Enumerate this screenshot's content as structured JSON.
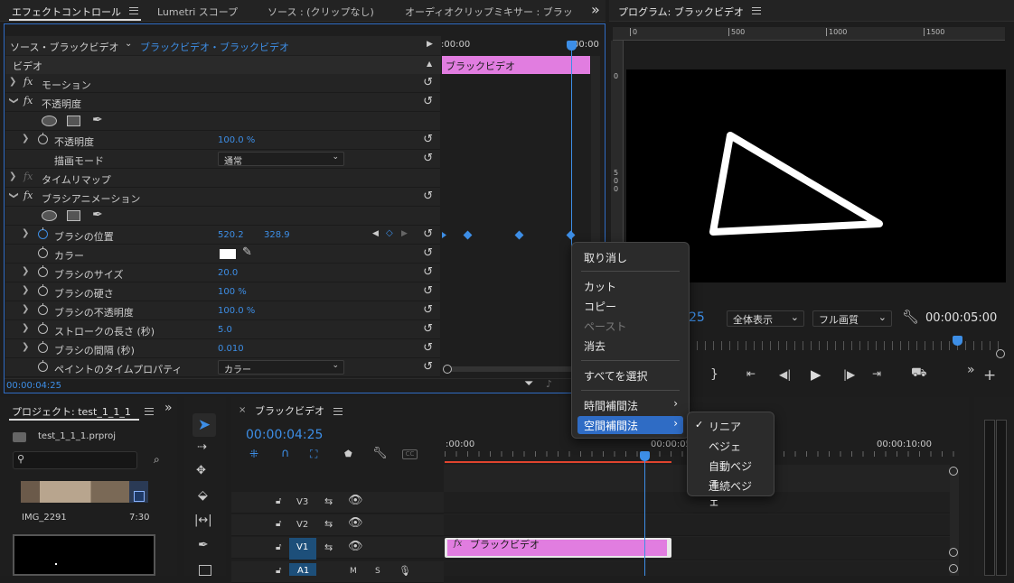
{
  "panel_tabs": {
    "effect_controls": "エフェクトコントロール",
    "lumetri": "Lumetri スコープ",
    "source": "ソース : (クリップなし)",
    "audio_mixer": "オーディオクリップミキサー : ブラッ",
    "overflow": "»"
  },
  "program": {
    "title": "プログラム: ブラックビデオ",
    "ruler": [
      "0",
      "500",
      "1000",
      "1500"
    ],
    "vruler": [
      "0",
      "5",
      "0",
      "0"
    ],
    "timecode_left": "25",
    "fit": "全体表示",
    "quality": "フル画質",
    "timecode": "00:00:05:00"
  },
  "effect_controls": {
    "source": "ソース・ブラックビデオ",
    "clip": "ブラックビデオ・ブラックビデオ",
    "section": "ビデオ",
    "mini_time_start": ":00:00",
    "mini_time_end": "00:00",
    "clip_bar": "ブラックビデオ",
    "timecode": "00:00:04:25",
    "rows": [
      {
        "label": "モーション"
      },
      {
        "label": "不透明度"
      },
      {
        "label": "不透明度",
        "value": "100.0 %"
      },
      {
        "label": "描画モード",
        "dropdown": "通常"
      },
      {
        "label": "タイムリマップ"
      },
      {
        "label": "ブラシアニメーション"
      },
      {
        "label": "ブラシの位置",
        "value": "520.2",
        "value2": "328.9"
      },
      {
        "label": "カラー"
      },
      {
        "label": "ブラシのサイズ",
        "value": "20.0"
      },
      {
        "label": "ブラシの硬さ",
        "value": "100 %"
      },
      {
        "label": "ブラシの不透明度",
        "value": "100.0 %"
      },
      {
        "label": "ストロークの長さ (秒)",
        "value": "5.0"
      },
      {
        "label": "ブラシの間隔 (秒)",
        "value": "0.010"
      },
      {
        "label": "ペイントのタイムプロパティ",
        "dropdown": "カラー"
      }
    ]
  },
  "context_menu": {
    "undo": "取り消し",
    "cut": "カット",
    "copy": "コピー",
    "paste": "ペースト",
    "clear": "消去",
    "select_all": "すべてを選択",
    "temporal": "時間補間法",
    "spatial": "空間補間法"
  },
  "submenu": {
    "items": [
      "リニア",
      "ベジェ",
      "自動ベジェ",
      "連続ベジェ"
    ],
    "checked": "リニア"
  },
  "project": {
    "title": "プロジェクト: test_1_1_1",
    "file": "test_1_1_1.prproj",
    "clip_name": "IMG_2291",
    "clip_duration": "7:30"
  },
  "timeline": {
    "title": "ブラックビデオ",
    "timecode": "00:00:04:25",
    "ruler": [
      ":00:00",
      "00:00:05:00",
      "00:00:10:00"
    ],
    "tracks": [
      "V3",
      "V2",
      "V1",
      "A1"
    ],
    "clip": "ブラックビデオ",
    "track_letters": [
      "M",
      "S"
    ]
  },
  "colors": {
    "accent": "#3d8ee6",
    "clip": "#e17de0",
    "menu_highlight": "#2f6cc5"
  }
}
